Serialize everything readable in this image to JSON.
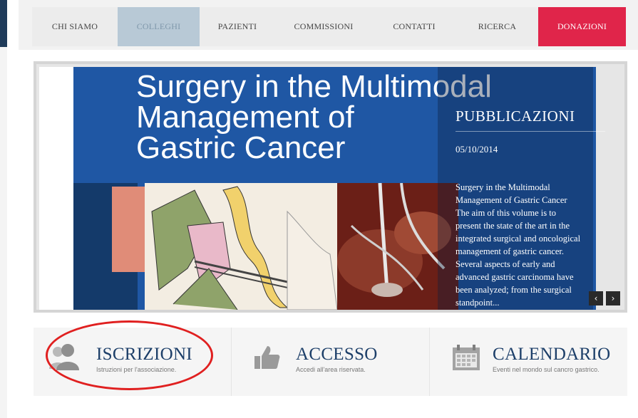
{
  "menu": {
    "items": [
      {
        "label": "CHI SIAMO"
      },
      {
        "label": "COLLEGHI"
      },
      {
        "label": "PAZIENTI"
      },
      {
        "label": "COMMISSIONI"
      },
      {
        "label": "CONTATTI"
      },
      {
        "label": "RICERCA"
      },
      {
        "label": "DONAZIONI"
      }
    ],
    "active": "COLLEGHI"
  },
  "slider": {
    "cover_title_lines": [
      "Surgery in the Multimodal",
      "Management of",
      "Gastric Cancer"
    ],
    "panel": {
      "heading": "PUBBLICAZIONI",
      "date": "05/10/2014",
      "text_lines": [
        "Surgery in the Multimodal",
        "Management of Gastric Cancer",
        "The aim of this volume is to",
        "present the state of the art in the",
        "integrated surgical and oncological",
        "management of gastric cancer.",
        "Several aspects of early and",
        "advanced gastric carcinoma have",
        "been analyzed; from the surgical",
        "standpoint..."
      ]
    },
    "prev_icon": "chevron-left-icon",
    "next_icon": "chevron-right-icon"
  },
  "features": [
    {
      "title": "ISCRIZIONI",
      "subtitle": "Istruzioni per l'associazione.",
      "icon": "users-icon"
    },
    {
      "title": "ACCESSO",
      "subtitle": "Accedi all'area riservata.",
      "icon": "thumbs-up-icon"
    },
    {
      "title": "CALENDARIO",
      "subtitle": "Eventi nel mondo sul cancro gastrico.",
      "icon": "calendar-icon"
    }
  ],
  "colors": {
    "donate": "#e0254a",
    "active_menu": "#b8c9d6",
    "feature_title": "#1d3f69",
    "highlight_circle": "#e02020"
  }
}
